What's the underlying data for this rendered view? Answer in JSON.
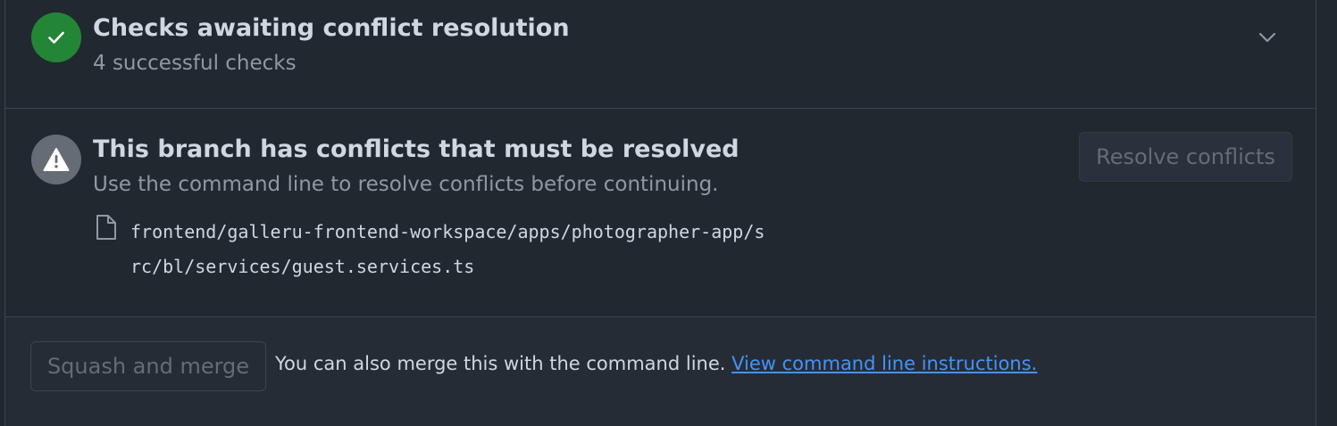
{
  "checks": {
    "title": "Checks awaiting conflict resolution",
    "subtitle": "4 successful checks",
    "status_color": "#238636",
    "status_icon": "check-icon",
    "toggle_icon": "chevron-down-icon"
  },
  "conflicts": {
    "title": "This branch has conflicts that must be resolved",
    "subtitle": "Use the command line to resolve conflicts before continuing.",
    "status_icon": "alert-icon",
    "resolve_button_label": "Resolve conflicts",
    "files": [
      {
        "icon": "file-icon",
        "path": "frontend/galleru-frontend-workspace/apps/photographer-app/src/bl/services/guest.services.ts"
      }
    ]
  },
  "merge": {
    "button_label": "Squash and merge",
    "note": "You can also merge this with the command line.",
    "link_text": "View command line instructions.",
    "link_color": "#4493f8"
  }
}
